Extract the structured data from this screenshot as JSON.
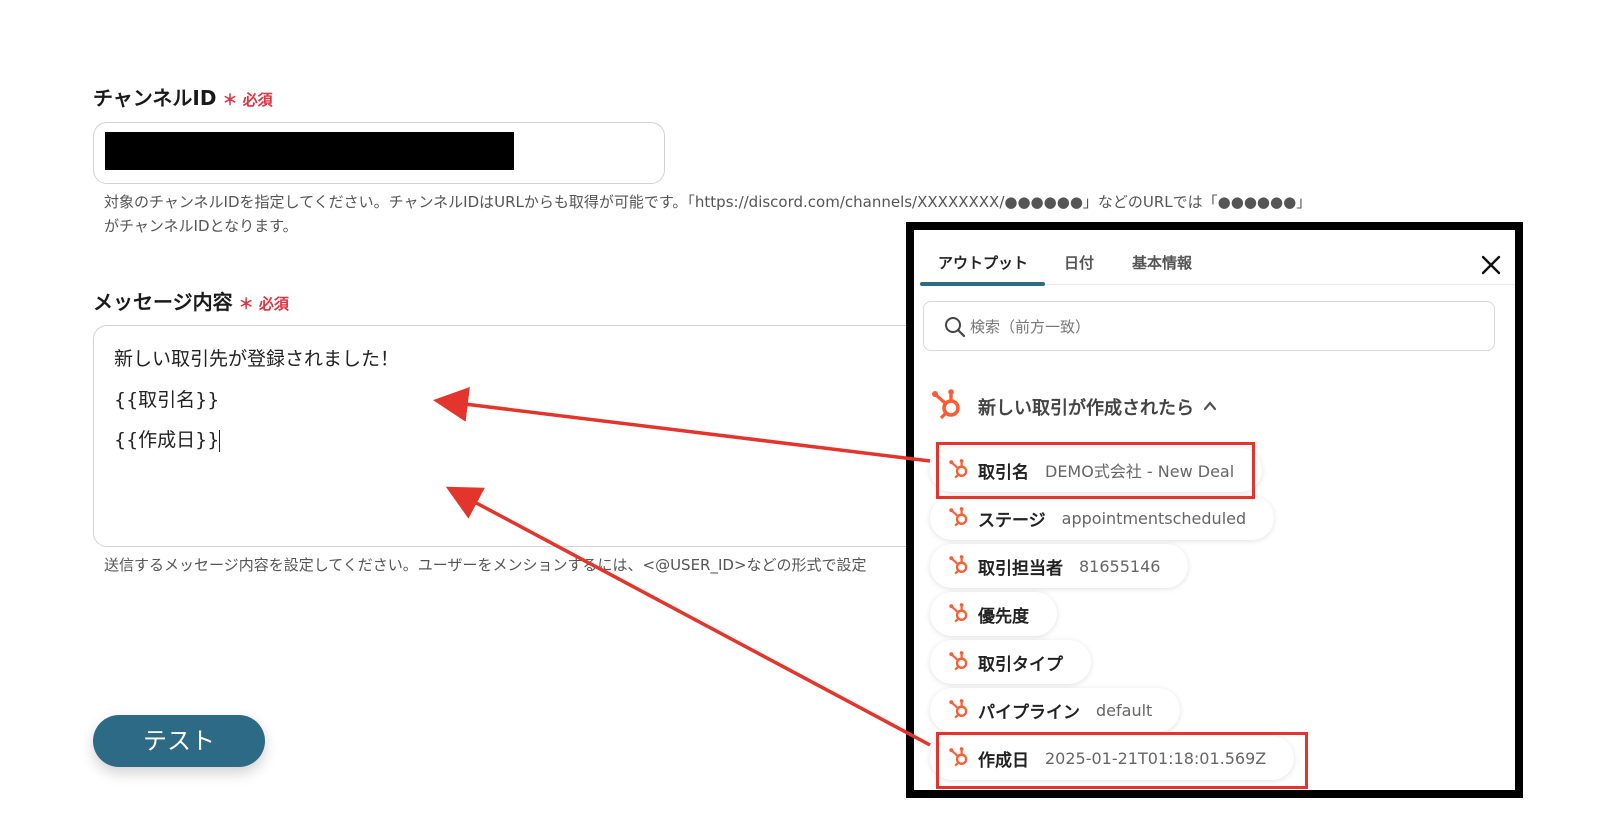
{
  "form": {
    "channel_label": "チャンネルID",
    "channel_required": "＊ 必須",
    "channel_help_line1": "対象のチャンネルIDを指定してください。チャンネルIDはURLからも取得が可能です。「https://discord.com/channels/XXXXXXXX/●●●●●●」などのURLでは「●●●●●●」",
    "channel_help_line2": "がチャンネルIDとなります。",
    "message_label": "メッセージ内容",
    "message_required": "＊ 必須",
    "message_lines": [
      "新しい取引先が登録されました！",
      "{{取引名}}",
      "{{作成日}}"
    ],
    "message_help": "送信するメッセージ内容を設定してください。ユーザーをメンションするには、<@USER_ID>などの形式で設定",
    "test_button": "テスト"
  },
  "popup": {
    "tabs": [
      "アウトプット",
      "日付",
      "基本情報"
    ],
    "search_placeholder": "検索（前方一致）",
    "group_title": "新しい取引が作成されたら",
    "items": [
      {
        "name": "取引名",
        "value": "DEMO式会社 - New Deal"
      },
      {
        "name": "ステージ",
        "value": "appointmentscheduled"
      },
      {
        "name": "取引担当者",
        "value": "81655146"
      },
      {
        "name": "優先度",
        "value": ""
      },
      {
        "name": "取引タイプ",
        "value": ""
      },
      {
        "name": "パイプライン",
        "value": "default"
      },
      {
        "name": "作成日",
        "value": "2025-01-21T01:18:01.569Z"
      }
    ]
  },
  "colors": {
    "accent": "#2d6a86",
    "required": "#e0323f",
    "hubspot": "#ff5c35",
    "highlight": "#e3352b"
  },
  "icons": [
    "hubspot-icon",
    "search-icon",
    "close-icon",
    "chevron-up-icon"
  ]
}
